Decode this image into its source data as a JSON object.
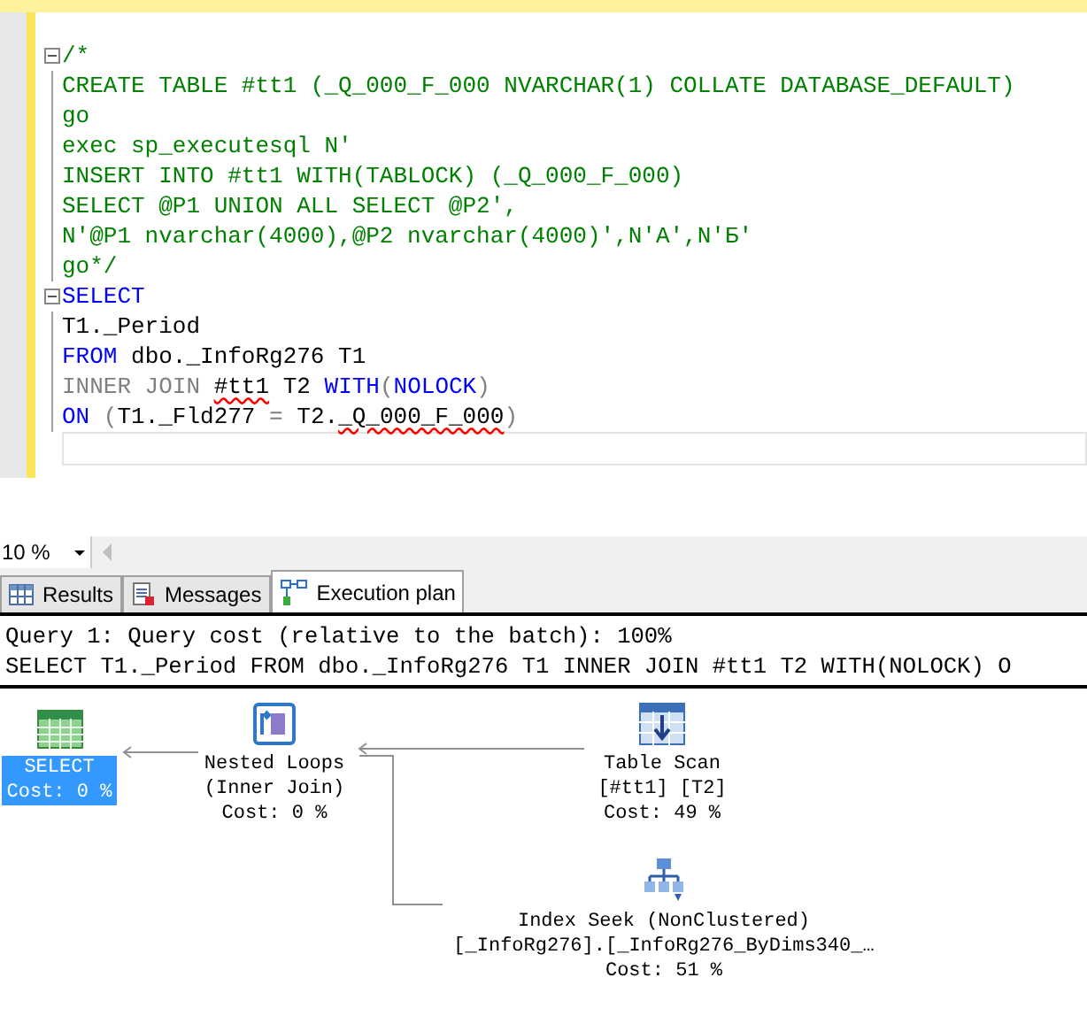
{
  "editor": {
    "lines": [
      {
        "fold": true,
        "tokens": [
          {
            "kind": "comment",
            "text": "/*"
          }
        ]
      },
      {
        "fold": false,
        "tokens": [
          {
            "kind": "comment",
            "text": "CREATE TABLE #tt1 (_Q_000_F_000 NVARCHAR(1) COLLATE DATABASE_DEFAULT)"
          }
        ]
      },
      {
        "fold": false,
        "tokens": [
          {
            "kind": "comment",
            "text": "go"
          }
        ]
      },
      {
        "fold": false,
        "tokens": [
          {
            "kind": "comment",
            "text": "exec sp_executesql N'"
          }
        ]
      },
      {
        "fold": false,
        "tokens": [
          {
            "kind": "comment",
            "text": "INSERT INTO #tt1 WITH(TABLOCK) (_Q_000_F_000)"
          }
        ]
      },
      {
        "fold": false,
        "tokens": [
          {
            "kind": "comment",
            "text": "SELECT @P1 UNION ALL SELECT @P2',"
          }
        ]
      },
      {
        "fold": false,
        "tokens": [
          {
            "kind": "comment",
            "text": "N'@P1 nvarchar(4000),@P2 nvarchar(4000)',N'А',N'Б'"
          }
        ]
      },
      {
        "fold": false,
        "tokens": [
          {
            "kind": "comment",
            "text": "go*/"
          }
        ]
      },
      {
        "fold": true,
        "tokens": [
          {
            "kind": "keyword",
            "text": "SELECT"
          }
        ]
      },
      {
        "fold": false,
        "tokens": [
          {
            "kind": "plain",
            "text": "T1._Period"
          }
        ]
      },
      {
        "fold": false,
        "tokens": [
          {
            "kind": "keyword",
            "text": "FROM"
          },
          {
            "kind": "plain",
            "text": " dbo._InfoRg276 T1"
          }
        ]
      },
      {
        "fold": false,
        "tokens": [
          {
            "kind": "gray",
            "text": "INNER JOIN "
          },
          {
            "kind": "error",
            "text": "#tt1"
          },
          {
            "kind": "plain",
            "text": " T2 "
          },
          {
            "kind": "keyword",
            "text": "WITH"
          },
          {
            "kind": "gray",
            "text": "("
          },
          {
            "kind": "keyword",
            "text": "NOLOCK"
          },
          {
            "kind": "gray",
            "text": ")"
          }
        ]
      },
      {
        "fold": false,
        "tokens": [
          {
            "kind": "keyword",
            "text": "ON"
          },
          {
            "kind": "gray",
            "text": " ("
          },
          {
            "kind": "plain",
            "text": "T1._Fld277 "
          },
          {
            "kind": "gray",
            "text": "="
          },
          {
            "kind": "plain",
            "text": " T2."
          },
          {
            "kind": "error",
            "text": "_Q_000_F_000"
          },
          {
            "kind": "gray",
            "text": ")"
          }
        ]
      }
    ]
  },
  "zoom": {
    "value": "10 %"
  },
  "result_tabs": [
    {
      "label": "Results",
      "kind": "grid",
      "selected": false
    },
    {
      "label": "Messages",
      "kind": "messages",
      "selected": false
    },
    {
      "label": "Execution plan",
      "kind": "plan",
      "selected": true
    }
  ],
  "plan": {
    "header": [
      "Query 1: Query cost (relative to the batch): 100%",
      "SELECT T1._Period FROM dbo._InfoRg276 T1 INNER JOIN #tt1 T2 WITH(NOLOCK) O"
    ],
    "nodes": [
      {
        "kind": "select",
        "selected": true,
        "lines": [
          "SELECT",
          "Cost: 0 %"
        ]
      },
      {
        "kind": "nested_loops",
        "selected": false,
        "lines": [
          "Nested Loops",
          "(Inner Join)",
          "Cost: 0 %"
        ]
      },
      {
        "kind": "table_scan",
        "selected": false,
        "lines": [
          "Table Scan",
          "[#tt1] [T2]",
          "Cost: 49 %"
        ]
      },
      {
        "kind": "index_seek",
        "selected": false,
        "lines": [
          "Index Seek (NonClustered)",
          "[_InfoRg276].[_InfoRg276_ByDims340_…",
          "Cost: 51 %"
        ]
      }
    ]
  }
}
